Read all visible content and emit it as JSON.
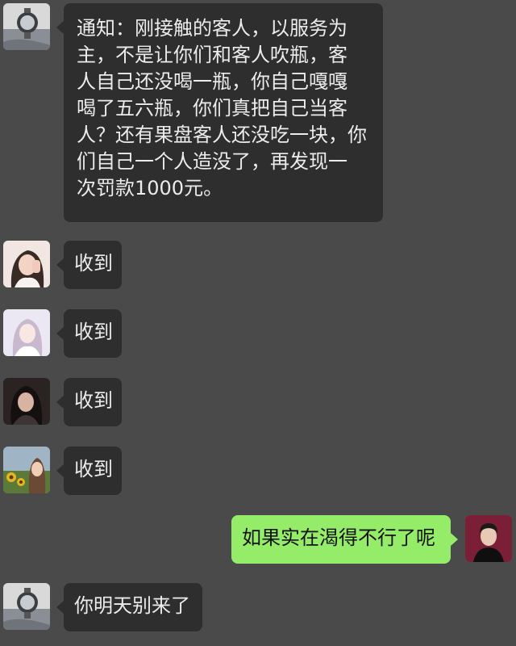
{
  "chat": {
    "messages": [
      {
        "direction": "incoming",
        "avatar": "watch-avatar-icon",
        "text": "通知：刚接触的客人，以服务为\n主，不是让你们和客人吹瓶，客\n人自己还没喝一瓶，你自己嘎嘎\n喝了五六瓶，你们真把自己当客\n人？还有果盘客人还没吃一块，你\n们自己一个人造没了，再发现一\n次罚款1000元。"
      },
      {
        "direction": "incoming",
        "avatar": "girl-avatar-1",
        "text": "收到"
      },
      {
        "direction": "incoming",
        "avatar": "girl-avatar-2",
        "text": "收到"
      },
      {
        "direction": "incoming",
        "avatar": "girl-avatar-3",
        "text": "收到"
      },
      {
        "direction": "incoming",
        "avatar": "sunflower-avatar",
        "text": "收到"
      },
      {
        "direction": "outgoing",
        "avatar": "boy-avatar",
        "text": "如果实在渴得不行了呢"
      },
      {
        "direction": "incoming",
        "avatar": "watch-avatar-icon",
        "text": "你明天别来了"
      }
    ]
  },
  "colors": {
    "background": "#4a4a4a",
    "incoming_bubble": "#2e2e2e",
    "outgoing_bubble": "#95ec69"
  }
}
